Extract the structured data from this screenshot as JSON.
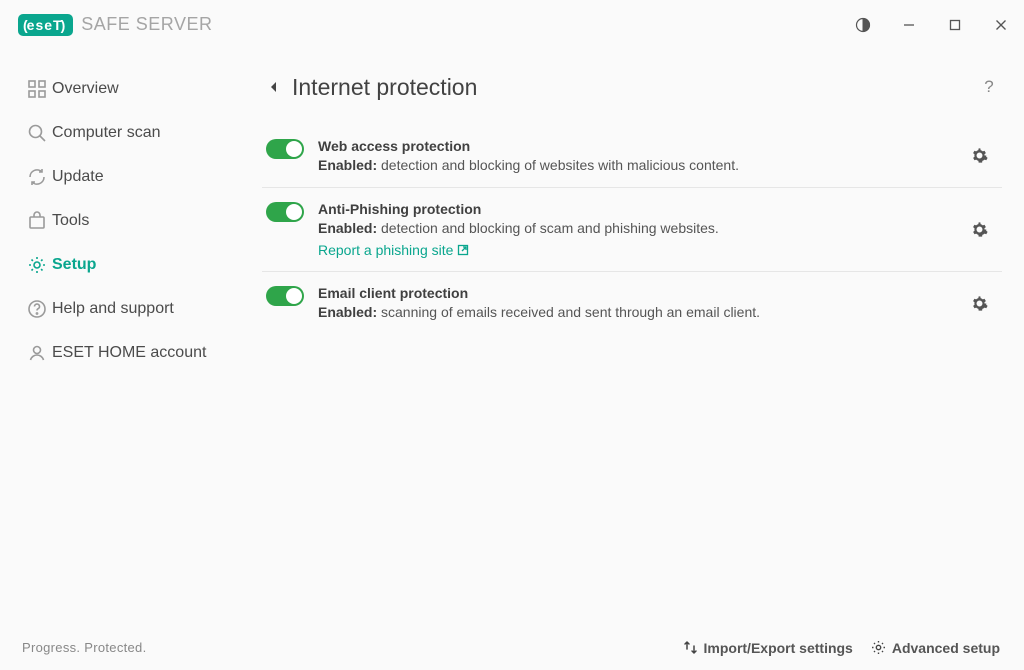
{
  "product": {
    "brand_text": "eseT",
    "name": "SAFE SERVER"
  },
  "sidebar": {
    "items": [
      {
        "label": "Overview"
      },
      {
        "label": "Computer scan"
      },
      {
        "label": "Update"
      },
      {
        "label": "Tools"
      },
      {
        "label": "Setup"
      },
      {
        "label": "Help and support"
      },
      {
        "label": "ESET HOME account"
      }
    ]
  },
  "page": {
    "title": "Internet protection"
  },
  "settings": [
    {
      "title": "Web access protection",
      "status_label": "Enabled:",
      "description": "detection and blocking of websites with malicious content."
    },
    {
      "title": "Anti-Phishing protection",
      "status_label": "Enabled:",
      "description": "detection and blocking of scam and phishing websites.",
      "link_text": "Report a phishing site"
    },
    {
      "title": "Email client protection",
      "status_label": "Enabled:",
      "description": "scanning of emails received and sent through an email client."
    }
  ],
  "footer": {
    "slogan": "Progress. Protected.",
    "import_export": "Import/Export settings",
    "advanced": "Advanced setup"
  }
}
